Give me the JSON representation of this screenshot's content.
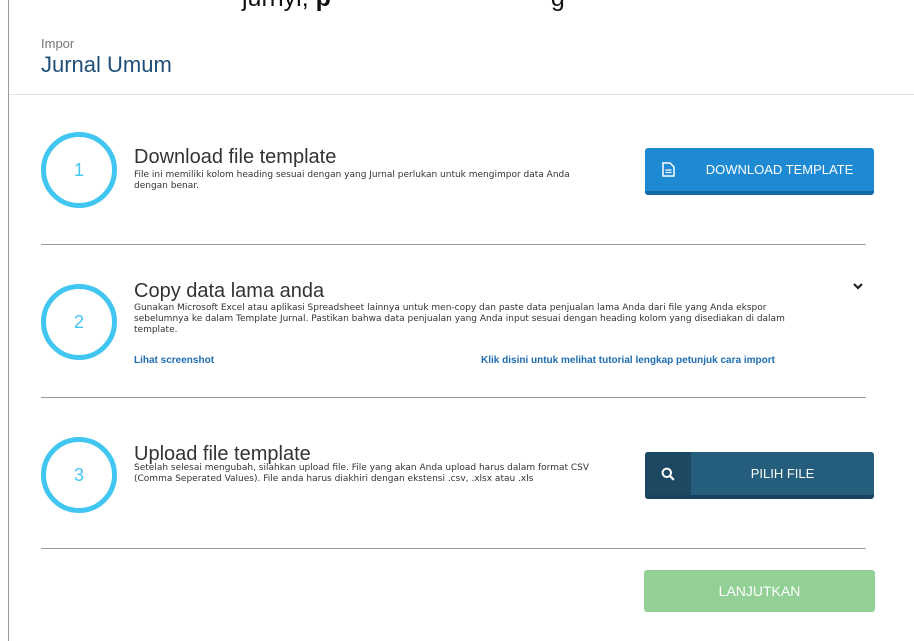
{
  "top_clip": {
    "text_pre": "jurnyi, ",
    "text_bold": "p",
    "text_post": "g"
  },
  "header": {
    "breadcrumb": "Impor",
    "title": "Jurnal Umum"
  },
  "steps": [
    {
      "number": "1",
      "title": "Download file template",
      "description": "File ini memiliki kolom heading sesuai dengan yang Jurnal perlukan untuk mengimpor data Anda dengan benar.",
      "button_label": "DOWNLOAD TEMPLATE",
      "button_icon": "document-icon"
    },
    {
      "number": "2",
      "title": "Copy data lama anda",
      "description": "Gunakan Microsoft Excel atau aplikasi Spreadsheet lainnya untuk men-copy dan paste data penjualan lama Anda dari file yang Anda ekspor sebelumnya ke dalam Template Jurnal. Pastikan bahwa data penjualan yang Anda input sesuai dengan heading kolom yang disediakan di dalam template.",
      "link_screenshot": "Lihat screenshot",
      "link_tutorial": "Klik disini untuk melihat tutorial lengkap petunjuk cara import",
      "toggle_icon": "chevron-down-icon"
    },
    {
      "number": "3",
      "title": "Upload file template",
      "description": "Setelah selesai mengubah, silahkan upload file. File yang akan Anda upload harus dalam format CSV (Comma Seperated Values). File anda harus diakhiri dengan ekstensi .csv, .xlsx atau .xls",
      "button_label": "PILIH FILE",
      "button_icon": "search-icon"
    }
  ],
  "footer": {
    "continue_label": "LANJUTKAN"
  },
  "colors": {
    "accent_circle": "#41c6f1",
    "download_button": "#1f8ad4",
    "pilih_button": "#255e7d",
    "continue_button": "#92d095",
    "title_blue": "#1f4e79",
    "link_blue": "#1f6db0"
  }
}
